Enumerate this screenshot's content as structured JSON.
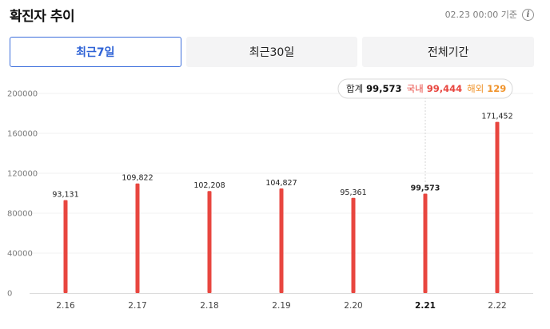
{
  "header": {
    "title": "확진자 추이",
    "updated": "02.23 00:00 기준",
    "info_icon": "info-icon"
  },
  "tabs": [
    {
      "label": "최근7일",
      "active": true
    },
    {
      "label": "최근30일",
      "active": false
    },
    {
      "label": "전체기간",
      "active": false
    }
  ],
  "colors": {
    "bar": "#e8463f",
    "accent_blue": "#2f63d6",
    "overseas": "#f0932b",
    "axis": "#7a7a7a",
    "grid": "#f0f0f0"
  },
  "chart_data": {
    "type": "bar",
    "title": "",
    "xlabel": "",
    "ylabel": "",
    "categories": [
      "2.16",
      "2.17",
      "2.18",
      "2.19",
      "2.20",
      "2.21",
      "2.22"
    ],
    "series": [
      {
        "values": [
          93131,
          109822,
          102208,
          104827,
          95361,
          99573,
          171452
        ]
      }
    ],
    "value_labels": [
      "93,131",
      "109,822",
      "102,208",
      "104,827",
      "95,361",
      "99,573",
      "171,452"
    ],
    "ylim": [
      0,
      200000
    ],
    "yticks": [
      0,
      40000,
      80000,
      120000,
      160000,
      200000
    ],
    "ytick_labels": [
      "0",
      "40000",
      "80000",
      "120000",
      "160000",
      "200000"
    ],
    "selected_index": 5,
    "tooltip": {
      "total_label": "합계",
      "total_value": "99,573",
      "domestic_label": "국내",
      "domestic_value": "99,444",
      "overseas_label": "해외",
      "overseas_value": "129"
    }
  }
}
